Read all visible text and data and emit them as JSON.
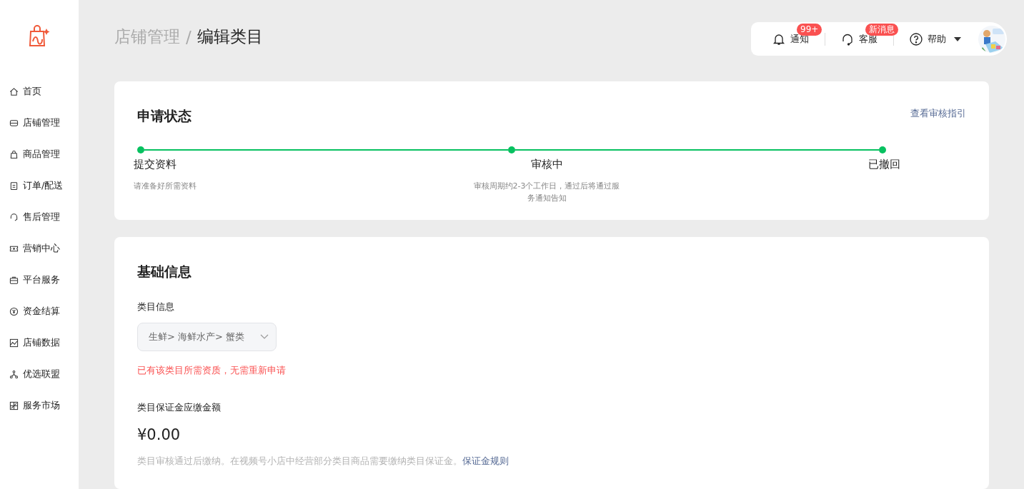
{
  "sidebar": {
    "items": [
      {
        "label": "首页",
        "selected": false
      },
      {
        "label": "店铺管理",
        "selected": false
      },
      {
        "label": "商品管理",
        "selected": false
      },
      {
        "label": "订单/配送",
        "selected": false
      },
      {
        "label": "售后管理",
        "selected": false
      },
      {
        "label": "营销中心",
        "selected": false
      },
      {
        "label": "平台服务",
        "selected": false
      },
      {
        "label": "资金结算",
        "selected": false
      },
      {
        "label": "店铺数据",
        "selected": false
      },
      {
        "label": "优选联盟",
        "selected": false
      },
      {
        "label": "服务市场",
        "selected": false
      }
    ]
  },
  "breadcrumb": {
    "parent": "店铺管理",
    "separator": "/",
    "current": "编辑类目"
  },
  "topbar": {
    "items": [
      {
        "label": "通知",
        "badge": "99+"
      },
      {
        "label": "客服",
        "badge": "新消息"
      },
      {
        "label": "帮助",
        "dropdown": true
      }
    ]
  },
  "status_card": {
    "title": "申请状态",
    "link": "查看审核指引",
    "steps": [
      {
        "title": "提交资料",
        "desc": "请准备好所需资料",
        "done": true
      },
      {
        "title": "审核中",
        "desc": "审核周期约2-3个工作日，通过后将通过服务通知告知",
        "done": true
      },
      {
        "title": "已撤回",
        "done": true
      }
    ]
  },
  "basic_card": {
    "title": "基础信息",
    "category_label": "类目信息",
    "category_path": "生鲜> 海鲜水产> 蟹类",
    "category_error": "已有该类目所需资质，无需重新申请",
    "deposit_label": "类目保证金应缴金额",
    "deposit_amount": "¥0.00",
    "deposit_note": "类目审核通过后缴纳。在视频号小店中经营部分类目商品需要缴纳类目保证金。",
    "deposit_link": "保证金规则"
  }
}
